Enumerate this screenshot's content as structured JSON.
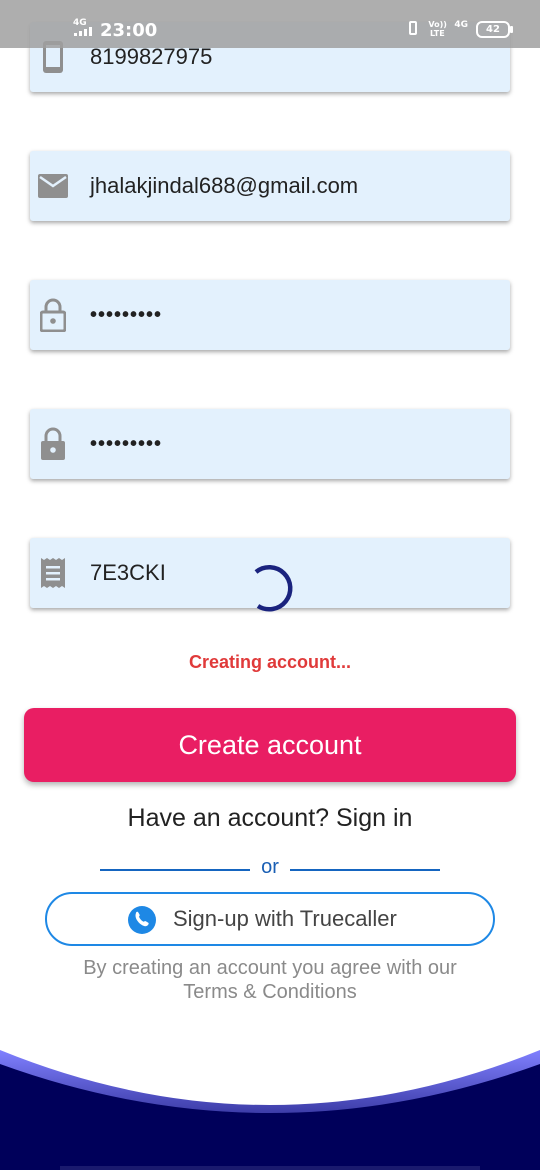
{
  "status_bar": {
    "network": "4G",
    "time": "23:00",
    "volte": "Vo)) LTE",
    "net2": "4G",
    "battery": "42"
  },
  "form": {
    "phone": {
      "icon": "phone-icon",
      "value": "8199827975"
    },
    "email": {
      "icon": "email-icon",
      "value": "jhalakjindal688@gmail.com"
    },
    "password": {
      "icon": "lock-open-icon",
      "value": "•••••••••"
    },
    "confirm_password": {
      "icon": "lock-icon",
      "value": "•••••••••"
    },
    "referral": {
      "icon": "receipt-icon",
      "value": "7E3CKI"
    }
  },
  "status_message": "Creating account...",
  "create_button": "Create account",
  "signin_text": "Have an account? Sign in",
  "divider_text": "or",
  "truecaller_button": "Sign-up with Truecaller",
  "terms_line1": "By creating an account you agree with our",
  "terms_line2": "Terms & Conditions",
  "colors": {
    "field_bg": "#e3f1fd",
    "accent": "#e91e63",
    "status_msg": "#e03a3a",
    "link_blue": "#1e88e5",
    "spinner": "#1a237e",
    "footer": "#00005a"
  }
}
